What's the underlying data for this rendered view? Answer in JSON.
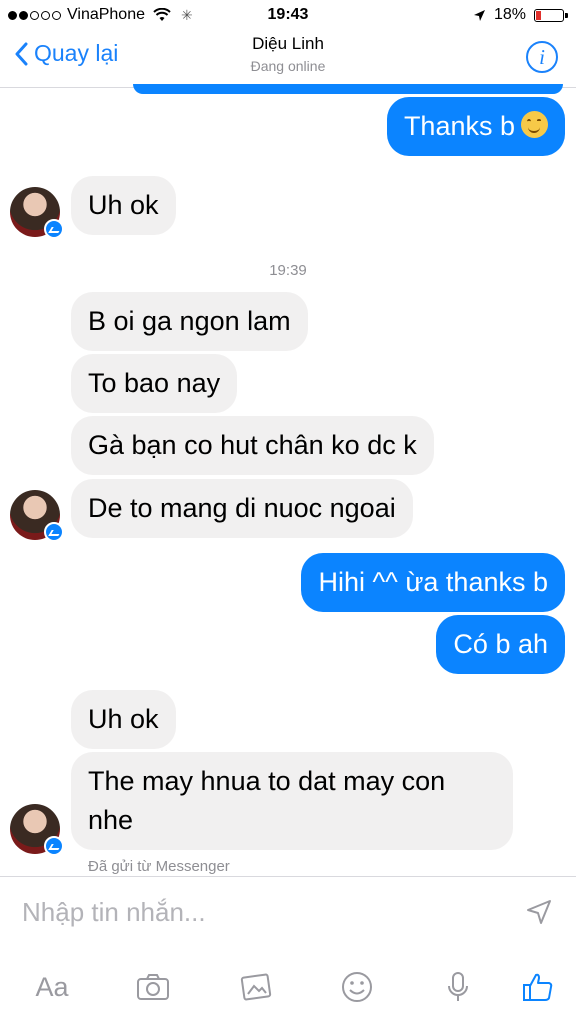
{
  "status_bar": {
    "carrier": "VinaPhone",
    "time": "19:43",
    "battery_percent": "18%",
    "battery_level": 0.18,
    "signal_bars_filled": 2,
    "signal_bars_total": 5
  },
  "nav": {
    "back_label": "Quay lại",
    "contact_name": "Diệu Linh",
    "contact_status": "Đang online",
    "info_label": "i"
  },
  "messages": [
    {
      "sender": "me",
      "text": "Thanks b"
    },
    {
      "sender": "contact",
      "text": "Uh ok"
    },
    {
      "sender": "contact",
      "text": "B oi ga ngon lam"
    },
    {
      "sender": "contact",
      "text": "To bao nay"
    },
    {
      "sender": "contact",
      "text": "Gà bạn co hut chân ko dc k"
    },
    {
      "sender": "contact",
      "text": "De to mang di nuoc ngoai"
    },
    {
      "sender": "me",
      "text": "Hihi ^^ ừa thanks b"
    },
    {
      "sender": "me",
      "text": "Có b ah"
    },
    {
      "sender": "contact",
      "text": "Uh ok"
    },
    {
      "sender": "contact",
      "text": "The may hnua to dat may con nhe"
    }
  ],
  "timestamp_divider": "19:39",
  "sent_via": "Đã gửi từ Messenger",
  "composer": {
    "placeholder": "Nhập tin nhắn...",
    "tools": [
      "Aa",
      "camera-icon",
      "photo-icon",
      "emoji-icon",
      "microphone-icon",
      "like-icon"
    ]
  },
  "colors": {
    "accent": "#0b84ff",
    "incoming_bubble": "#f1f0f0",
    "meta_text": "#8e8e93"
  }
}
